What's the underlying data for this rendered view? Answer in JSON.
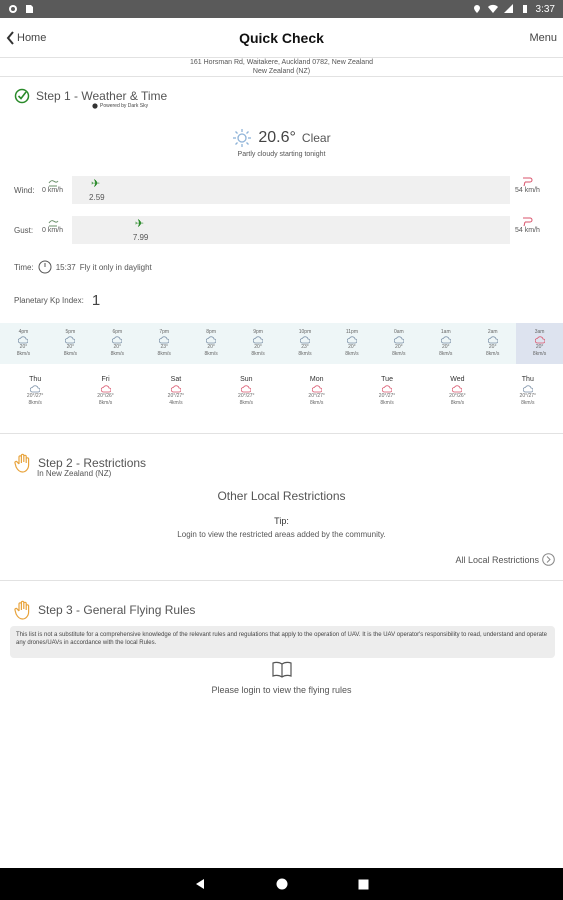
{
  "status_bar": {
    "time": "3:37"
  },
  "app_bar": {
    "back_label": "Home",
    "title": "Quick Check",
    "menu_label": "Menu"
  },
  "address": {
    "line1": "161 Horsman Rd, Waitakere, Auckland 0782, New Zealand",
    "line2": "New Zealand (NZ)"
  },
  "step1": {
    "title": "Step 1 - Weather & Time",
    "powered_by": "Powered by Dark Sky",
    "temperature": "20.6°",
    "condition": "Clear",
    "summary": "Partly cloudy starting tonight",
    "wind": {
      "label": "Wind:",
      "min": "0 km/h",
      "max": "54 km/h",
      "value": "2.59",
      "fraction": 0.048
    },
    "gust": {
      "label": "Gust:",
      "min": "0 km/h",
      "max": "54 km/h",
      "value": "7.99",
      "fraction": 0.148
    },
    "time": {
      "label": "Time:",
      "value": "15:37",
      "note": "Fly it only in daylight"
    },
    "kp": {
      "label": "Planetary Kp Index:",
      "value": "1"
    }
  },
  "hourly": [
    {
      "time": "4pm",
      "temp": "20°",
      "wind": "8km/s"
    },
    {
      "time": "5pm",
      "temp": "20°",
      "wind": "8km/s"
    },
    {
      "time": "6pm",
      "temp": "20°",
      "wind": "8km/s"
    },
    {
      "time": "7pm",
      "temp": "23°",
      "wind": "8km/s"
    },
    {
      "time": "8pm",
      "temp": "20°",
      "wind": "8km/s"
    },
    {
      "time": "9pm",
      "temp": "20°",
      "wind": "8km/s"
    },
    {
      "time": "10pm",
      "temp": "23°",
      "wind": "8km/s"
    },
    {
      "time": "11pm",
      "temp": "20°",
      "wind": "8km/s"
    },
    {
      "time": "0am",
      "temp": "20°",
      "wind": "8km/s"
    },
    {
      "time": "1am",
      "temp": "20°",
      "wind": "8km/s"
    },
    {
      "time": "2am",
      "temp": "20°",
      "wind": "8km/s"
    },
    {
      "time": "3am",
      "temp": "20°",
      "wind": "8km/s"
    }
  ],
  "daily": [
    {
      "day": "Thu",
      "temp": "20°/27°",
      "wind": "8km/s"
    },
    {
      "day": "Fri",
      "temp": "20°/26°",
      "wind": "8km/s"
    },
    {
      "day": "Sat",
      "temp": "20°/27°",
      "wind": "4km/s"
    },
    {
      "day": "Sun",
      "temp": "20°/27°",
      "wind": "8km/s"
    },
    {
      "day": "Mon",
      "temp": "20°/27°",
      "wind": "8km/s"
    },
    {
      "day": "Tue",
      "temp": "20°/27°",
      "wind": "8km/s"
    },
    {
      "day": "Wed",
      "temp": "20°/26°",
      "wind": "8km/s"
    },
    {
      "day": "Thu",
      "temp": "20°/27°",
      "wind": "8km/s"
    }
  ],
  "step2": {
    "title": "Step 2 - Restrictions",
    "subtitle": "In New Zealand (NZ)",
    "other_title": "Other Local Restrictions",
    "tip_label": "Tip:",
    "tip_text": "Login to view the restricted areas added by the community.",
    "all_link": "All Local Restrictions"
  },
  "step3": {
    "title": "Step 3 - General Flying Rules",
    "disclaimer": "This list is not a substitute for a comprehensive knowledge of the relevant rules and regulations that apply to the operation of UAV. It is the UAV operator's responsibility to read, understand and operate any drones/UAVs in accordance with the local Rules.",
    "login_text": "Please login to view the flying rules"
  },
  "colors": {
    "accent_green": "#2a8a2a",
    "hand_orange": "#e8a33c",
    "max_pink": "#d9536b"
  }
}
